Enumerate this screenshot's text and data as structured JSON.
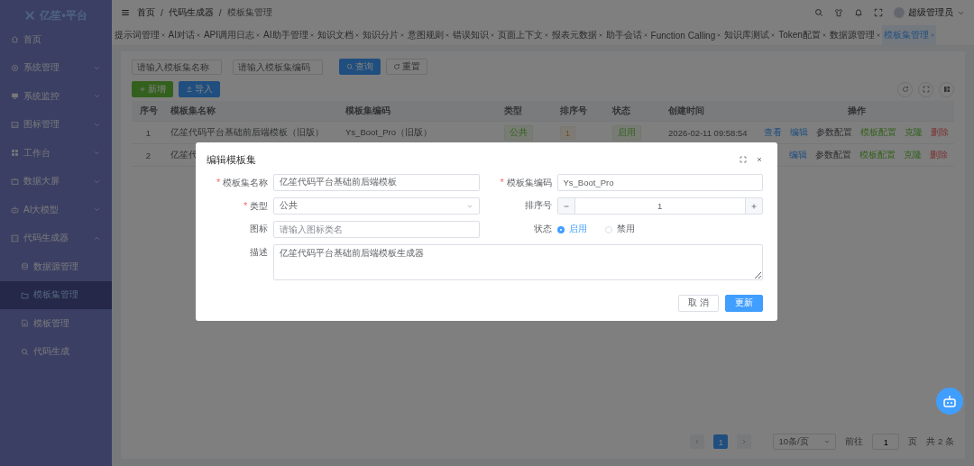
{
  "logo": {
    "text": "亿笙•平台"
  },
  "sidebar": {
    "items": [
      {
        "label": "首页",
        "expandable": false,
        "selected": false
      },
      {
        "label": "系统管理",
        "expandable": true,
        "expanded": false,
        "selected": false
      },
      {
        "label": "系统监控",
        "expandable": true,
        "expanded": false,
        "selected": false
      },
      {
        "label": "图标管理",
        "expandable": true,
        "expanded": false,
        "selected": false
      },
      {
        "label": "工作台",
        "expandable": true,
        "expanded": false,
        "selected": false
      },
      {
        "label": "数据大屏",
        "expandable": true,
        "expanded": false,
        "selected": false
      },
      {
        "label": "AI大模型",
        "expandable": true,
        "expanded": false,
        "selected": false
      },
      {
        "label": "代码生成器",
        "expandable": true,
        "expanded": true,
        "selected": false,
        "children": [
          {
            "label": "数据源管理",
            "selected": false
          },
          {
            "label": "模板集管理",
            "selected": true
          },
          {
            "label": "模板管理",
            "selected": false
          },
          {
            "label": "代码生成",
            "selected": false
          }
        ]
      }
    ]
  },
  "breadcrumb": {
    "separator": "/",
    "items": [
      "首页",
      "代码生成器",
      "模板集管理"
    ]
  },
  "user": {
    "name": "超级管理员"
  },
  "tabs": [
    {
      "label": "提示词管理",
      "selected": false
    },
    {
      "label": "AI对话",
      "selected": false
    },
    {
      "label": "API调用日志",
      "selected": false
    },
    {
      "label": "AI助手管理",
      "selected": false
    },
    {
      "label": "知识文档",
      "selected": false
    },
    {
      "label": "知识分片",
      "selected": false
    },
    {
      "label": "意图规则",
      "selected": false
    },
    {
      "label": "错误知识",
      "selected": false
    },
    {
      "label": "页面上下文",
      "selected": false
    },
    {
      "label": "报表元数据",
      "selected": false
    },
    {
      "label": "助手会话",
      "selected": false
    },
    {
      "label": "Function Calling",
      "selected": false
    },
    {
      "label": "知识库测试",
      "selected": false
    },
    {
      "label": "Token配置",
      "selected": false
    },
    {
      "label": "数据源管理",
      "selected": false
    },
    {
      "label": "模板集管理",
      "selected": true
    }
  ],
  "search": {
    "fields": [
      {
        "placeholder": "请输入模板集名称"
      },
      {
        "placeholder": "请输入模板集编码"
      }
    ],
    "query_button": "查询",
    "reset_button": "重置"
  },
  "toolbar": {
    "add_button": "新增",
    "import_button": "导入"
  },
  "table": {
    "columns": [
      "序号",
      "模板集名称",
      "模板集编码",
      "类型",
      "排序号",
      "状态",
      "创建时间",
      "操作"
    ],
    "rows": [
      {
        "cells": [
          "1",
          "亿笙代码平台基础前后端模板（旧版）",
          "Ys_Boot_Pro（旧版）",
          "公共",
          "1",
          "启用",
          "2026-02-11 09:58:54"
        ],
        "actions": [
          "查看",
          "编辑",
          "参数配置",
          "模板配置",
          "克隆",
          "删除"
        ]
      },
      {
        "cells": [
          "2",
          "亿笙代"
        ],
        "actions": [
          "编辑",
          "参数配置",
          "模板配置",
          "克隆",
          "删除"
        ]
      }
    ]
  },
  "pagination": {
    "pages": [
      {
        "label": "1",
        "selected": true
      }
    ],
    "page_size": "10条/页",
    "goto_label": "前往",
    "goto_value": "1",
    "page_unit": "页",
    "total": "共 2 条"
  },
  "dialog": {
    "title": "编辑模板集",
    "required_mark": "*",
    "fields": [
      {
        "kind": "text",
        "label": "模板集名称",
        "required": true,
        "value": "亿笙代码平台基础前后端模板"
      },
      {
        "kind": "text",
        "label": "模板集编码",
        "required": true,
        "value": "Ys_Boot_Pro"
      },
      {
        "kind": "select",
        "label": "类型",
        "required": true,
        "value": "公共"
      },
      {
        "kind": "number",
        "label": "排序号",
        "required": false,
        "value": "1"
      },
      {
        "kind": "text",
        "label": "图标",
        "required": false,
        "placeholder": "请输入图标类名"
      },
      {
        "kind": "radio",
        "label": "状态",
        "required": false,
        "options": [
          {
            "label": "启用",
            "selected": true
          },
          {
            "label": "禁用",
            "selected": false
          }
        ]
      },
      {
        "kind": "textarea",
        "label": "描述",
        "required": false,
        "value": "亿笙代码平台基础前后端模板生成器"
      }
    ],
    "cancel_button": "取 消",
    "submit_button": "更新"
  }
}
